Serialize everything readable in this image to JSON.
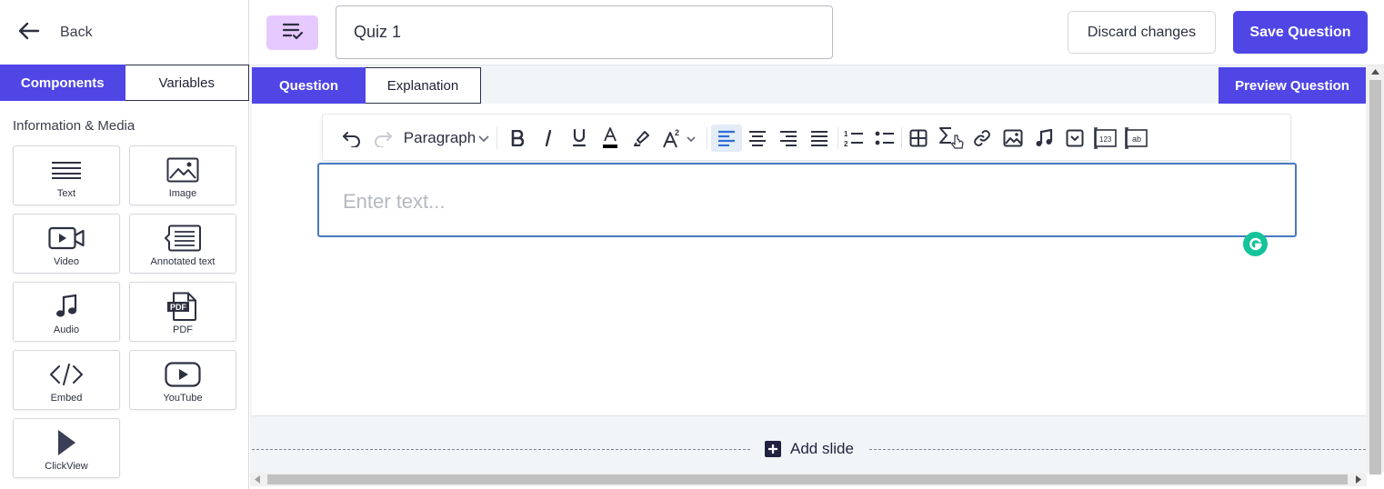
{
  "header": {
    "back_label": "Back",
    "quiz_title_value": "Quiz 1",
    "discard_label": "Discard changes",
    "save_label": "Save Question"
  },
  "sidebar": {
    "tabs": [
      {
        "label": "Components",
        "active": true
      },
      {
        "label": "Variables",
        "active": false
      }
    ],
    "section_title": "Information & Media",
    "components": [
      {
        "label": "Text",
        "icon": "text-lines-icon"
      },
      {
        "label": "Image",
        "icon": "image-icon"
      },
      {
        "label": "Video",
        "icon": "video-icon"
      },
      {
        "label": "Annotated text",
        "icon": "annotated-text-icon"
      },
      {
        "label": "Audio",
        "icon": "music-note-icon"
      },
      {
        "label": "PDF",
        "icon": "pdf-icon"
      },
      {
        "label": "Embed",
        "icon": "code-icon"
      },
      {
        "label": "YouTube",
        "icon": "youtube-icon"
      },
      {
        "label": "ClickView",
        "icon": "play-triangle-icon"
      }
    ]
  },
  "editor": {
    "tabs": [
      {
        "label": "Question",
        "active": true
      },
      {
        "label": "Explanation",
        "active": false
      }
    ],
    "preview_label": "Preview Question",
    "toolbar": {
      "paragraph_label": "Paragraph",
      "tools": [
        "undo",
        "redo",
        "paragraph",
        "bold",
        "italic",
        "underline",
        "font-color",
        "highlight",
        "superscript",
        "align-left",
        "align-center",
        "align-right",
        "align-justify",
        "ordered-list",
        "bullet-list",
        "table",
        "sigma",
        "link",
        "image",
        "audio",
        "dropdown",
        "number-input",
        "text-input"
      ],
      "active_tool": "align-left",
      "font_color_swatch": "#000000"
    },
    "text_placeholder": "Enter text...",
    "add_slide_label": "Add slide"
  },
  "colors": {
    "accent": "#4f46e5",
    "quiz_icon_bg": "#e6c9ff",
    "grammarly": "#15c39a"
  }
}
